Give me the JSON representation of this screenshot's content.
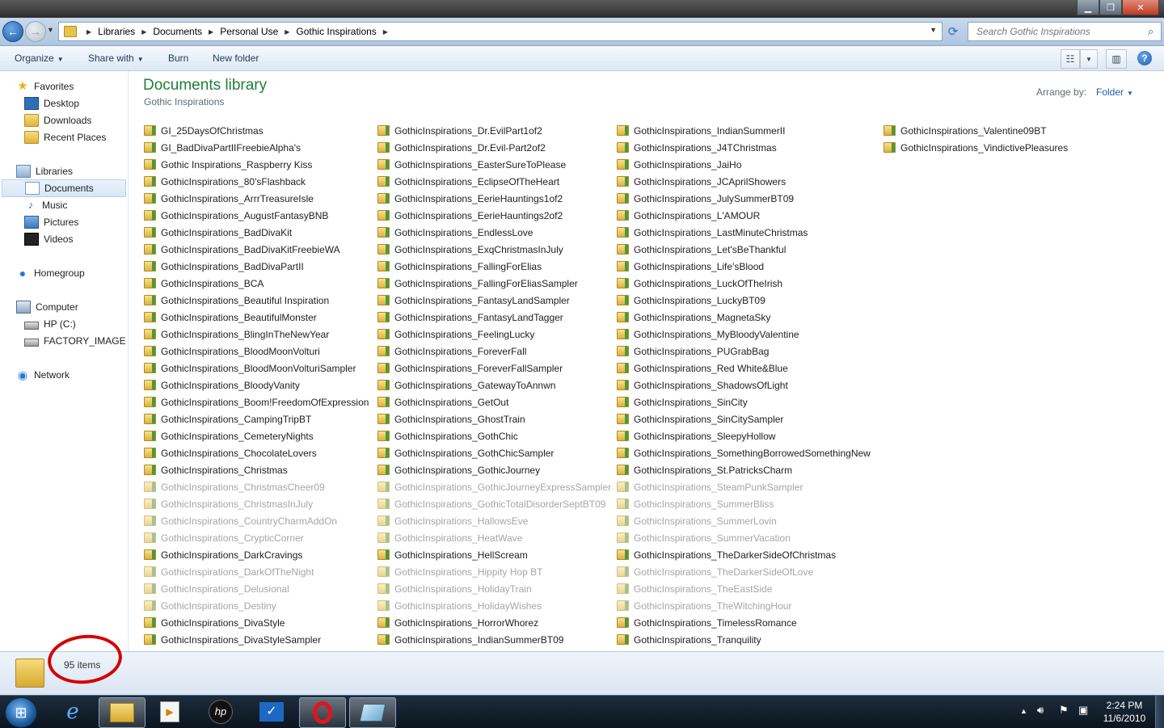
{
  "address": {
    "crumbs": [
      "Libraries",
      "Documents",
      "Personal Use",
      "Gothic Inspirations"
    ],
    "search_placeholder": "Search Gothic Inspirations"
  },
  "toolbar": {
    "organize": "Organize",
    "share_with": "Share with",
    "burn": "Burn",
    "new_folder": "New folder"
  },
  "nav": {
    "favorites": "Favorites",
    "desktop": "Desktop",
    "downloads": "Downloads",
    "recent_places": "Recent Places",
    "libraries": "Libraries",
    "documents": "Documents",
    "music": "Music",
    "pictures": "Pictures",
    "videos": "Videos",
    "homegroup": "Homegroup",
    "computer": "Computer",
    "hp_c": "HP (C:)",
    "factory_image": "FACTORY_IMAGE (D",
    "network": "Network"
  },
  "content": {
    "title": "Documents library",
    "subtitle": "Gothic Inspirations",
    "arrange_label": "Arrange by:",
    "arrange_value": "Folder"
  },
  "files": {
    "col1": [
      "GI_25DaysOfChristmas",
      "GI_BadDivaPartIIFreebieAlpha's",
      "Gothic Inspirations_Raspberry Kiss",
      "GothicInspirations_80'sFlashback",
      "GothicInspirations_ArrrTreasureIsle",
      "GothicInspirations_AugustFantasyBNB",
      "GothicInspirations_BadDivaKit",
      "GothicInspirations_BadDivaKitFreebieWA",
      "GothicInspirations_BadDivaPartII",
      "GothicInspirations_BCA",
      "GothicInspirations_Beautiful Inspiration",
      "GothicInspirations_BeautifulMonster",
      "GothicInspirations_BlingInTheNewYear",
      "GothicInspirations_BloodMoonVolturi",
      "GothicInspirations_BloodMoonVolturiSampler",
      "GothicInspirations_BloodyVanity",
      "GothicInspirations_Boom!FreedomOfExpression",
      "GothicInspirations_CampingTripBT",
      "GothicInspirations_CemeteryNights",
      "GothicInspirations_ChocolateLovers",
      "GothicInspirations_Christmas",
      "GothicInspirations_ChristmasCheer09",
      "GothicInspirations_ChristmasInJuly",
      "GothicInspirations_CountryCharmAddOn",
      "GothicInspirations_CrypticCorner",
      "GothicInspirations_DarkCravings",
      "GothicInspirations_DarkOfTheNight",
      "GothicInspirations_Delusional",
      "GothicInspirations_Destiny",
      "GothicInspirations_DivaStyle",
      "GothicInspirations_DivaStyleSampler"
    ],
    "col2": [
      "GothicInspirations_Dr.EvilPart1of2",
      "GothicInspirations_Dr.Evil-Part2of2",
      "GothicInspirations_EasterSureToPlease",
      "GothicInspirations_EclipseOfTheHeart",
      "GothicInspirations_EerieHauntings1of2",
      "GothicInspirations_EerieHauntings2of2",
      "GothicInspirations_EndlessLove",
      "GothicInspirations_ExqChristmasInJuly",
      "GothicInspirations_FallingForElias",
      "GothicInspirations_FallingForEliasSampler",
      "GothicInspirations_FantasyLandSampler",
      "GothicInspirations_FantasyLandTagger",
      "GothicInspirations_FeelingLucky",
      "GothicInspirations_ForeverFall",
      "GothicInspirations_ForeverFallSampler",
      "GothicInspirations_GatewayToAnnwn",
      "GothicInspirations_GetOut",
      "GothicInspirations_GhostTrain",
      "GothicInspirations_GothChic",
      "GothicInspirations_GothChicSampler",
      "GothicInspirations_GothicJourney",
      "GothicInspirations_GothicJourneyExpressSampler",
      "GothicInspirations_GothicTotalDisorderSeptBT09",
      "GothicInspirations_HallowsEve",
      "GothicInspirations_HeatWave",
      "GothicInspirations_HellScream",
      "GothicInspirations_Hippity Hop BT",
      "GothicInspirations_HolidayTrain",
      "GothicInspirations_HolidayWishes",
      "GothicInspirations_HorrorWhorez",
      "GothicInspirations_IndianSummerBT09"
    ],
    "col3": [
      "GothicInspirations_IndianSummerII",
      "GothicInspirations_J4TChristmas",
      "GothicInspirations_JaiHo",
      "GothicInspirations_JCAprilShowers",
      "GothicInspirations_JulySummerBT09",
      "GothicInspirations_L'AMOUR",
      "GothicInspirations_LastMinuteChristmas",
      "GothicInspirations_Let'sBeThankful",
      "GothicInspirations_Life'sBlood",
      "GothicInspirations_LuckOfTheIrish",
      "GothicInspirations_LuckyBT09",
      "GothicInspirations_MagnetaSky",
      "GothicInspirations_MyBloodyValentine",
      "GothicInspirations_PUGrabBag",
      "GothicInspirations_Red White&Blue",
      "GothicInspirations_ShadowsOfLight",
      "GothicInspirations_SinCity",
      "GothicInspirations_SinCitySampler",
      "GothicInspirations_SleepyHollow",
      "GothicInspirations_SomethingBorrowedSomethingNew",
      "GothicInspirations_St.PatricksCharm",
      "GothicInspirations_SteamPunkSampler",
      "GothicInspirations_SummerBliss",
      "GothicInspirations_SummerLovin",
      "GothicInspirations_SummerVacation",
      "GothicInspirations_TheDarkerSideOfChristmas",
      "GothicInspirations_TheDarkerSideOfLove",
      "GothicInspirations_TheEastSide",
      "GothicInspirations_TheWitchingHour",
      "GothicInspirations_TimelessRomance",
      "GothicInspirations_Tranquility"
    ],
    "col4": [
      "GothicInspirations_Valentine09BT",
      "GothicInspirations_VindictivePleasures"
    ]
  },
  "faded_rows": [
    21,
    22,
    23,
    24,
    26,
    27,
    28
  ],
  "status": {
    "count": "95 items"
  },
  "taskbar": {
    "time": "2:24 PM",
    "date": "11/6/2010"
  },
  "annotation_color": "#d40000"
}
